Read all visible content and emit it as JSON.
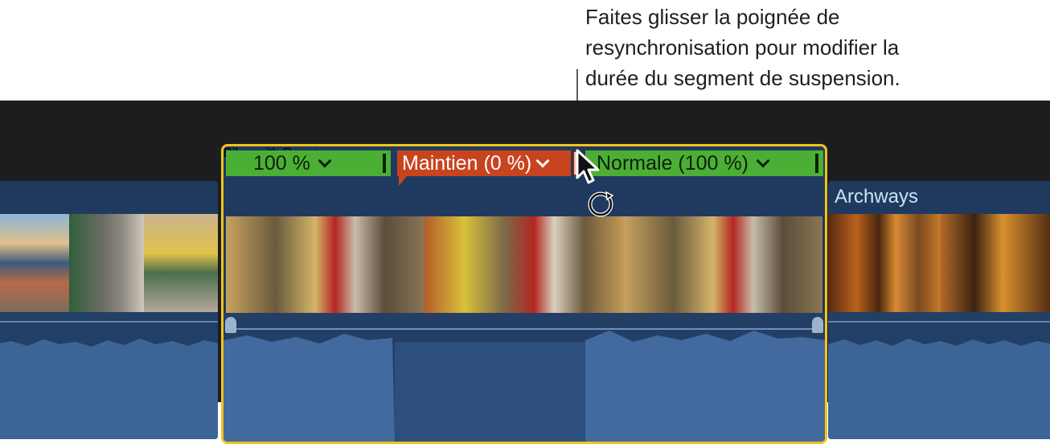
{
  "callout": {
    "lines": [
      "Faites glisser la poignée de",
      "resynchronisation pour modifier la",
      "durée du segment de suspension."
    ]
  },
  "timeline": {
    "clips": {
      "left": {
        "title": ""
      },
      "main": {
        "title": "Biker with Roses",
        "speed_segments": [
          {
            "label": "100 %",
            "color": "#4caf35"
          },
          {
            "label": "Maintien (0 %)",
            "color": "#c8441e"
          },
          {
            "label": "Normale (100 %)",
            "color": "#4caf35"
          }
        ]
      },
      "right": {
        "title": "Archways"
      }
    }
  },
  "colors": {
    "selection_border": "#f0c419",
    "clip_blue": "#1f3a5e",
    "speed_normal": "#4caf35",
    "speed_hold": "#c8441e"
  },
  "icons": [
    "pointer-cursor-icon",
    "retime-cursor-icon",
    "chevron-down-icon"
  ]
}
